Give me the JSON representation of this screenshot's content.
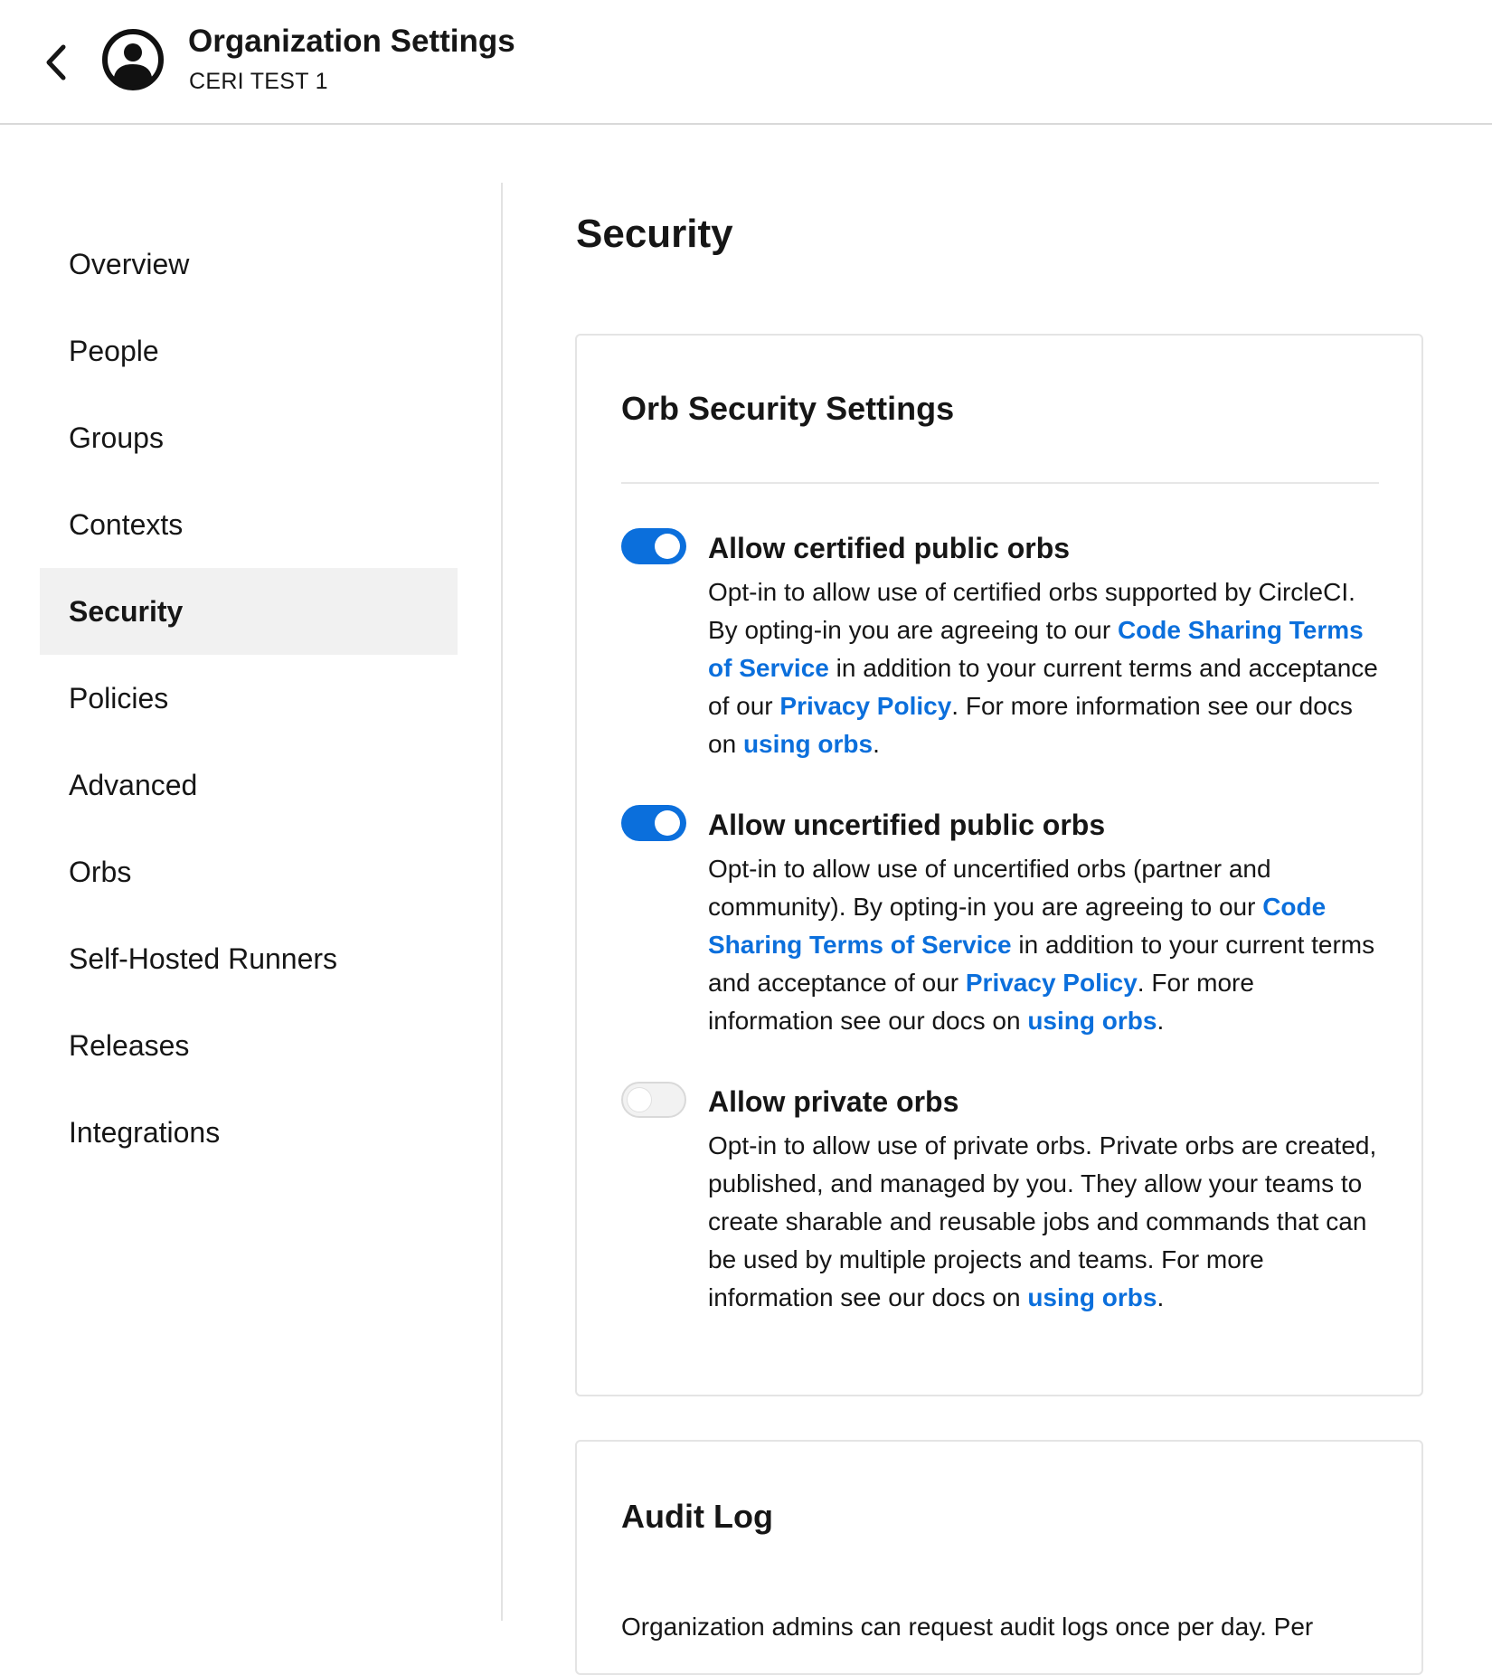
{
  "header": {
    "title": "Organization Settings",
    "org_name": "CERI TEST 1"
  },
  "sidebar": {
    "items": [
      {
        "label": "Overview"
      },
      {
        "label": "People"
      },
      {
        "label": "Groups"
      },
      {
        "label": "Contexts"
      },
      {
        "label": "Security",
        "active": true
      },
      {
        "label": "Policies"
      },
      {
        "label": "Advanced"
      },
      {
        "label": "Orbs"
      },
      {
        "label": "Self-Hosted Runners"
      },
      {
        "label": "Releases"
      },
      {
        "label": "Integrations"
      }
    ]
  },
  "main": {
    "title": "Security",
    "orb_settings": {
      "title": "Orb Security Settings",
      "settings": [
        {
          "title": "Allow certified public orbs",
          "enabled": true,
          "desc_1": "Opt-in to allow use of certified orbs supported by CircleCI. By opting-in you are agreeing to our ",
          "link_terms": "Code Sharing Terms of Service",
          "desc_2": " in addition to your current terms and acceptance of our ",
          "link_privacy": "Privacy Policy",
          "desc_3": ". For more information see our docs on ",
          "link_docs": "using orbs",
          "desc_4": "."
        },
        {
          "title": "Allow uncertified public orbs",
          "enabled": true,
          "desc_1": "Opt-in to allow use of uncertified orbs (partner and community). By opting-in you are agreeing to our ",
          "link_terms": "Code Sharing Terms of Service",
          "desc_2": " in addition to your current terms and acceptance of our ",
          "link_privacy": "Privacy Policy",
          "desc_3": ". For more information see our docs on ",
          "link_docs": "using orbs",
          "desc_4": "."
        },
        {
          "title": "Allow private orbs",
          "enabled": false,
          "desc_1": "Opt-in to allow use of private orbs. Private orbs are created, published, and managed by you. They allow your teams to create sharable and reusable jobs and commands that can be used by multiple projects and teams. For more information see our docs on ",
          "link_docs": "using orbs",
          "desc_4": "."
        }
      ]
    },
    "audit_log": {
      "title": "Audit Log",
      "text": "Organization admins can request audit logs once per day. Per"
    }
  },
  "colors": {
    "accent": "#0b6fdc",
    "active_nav_bg": "#f1f1f1",
    "text": "#161616"
  }
}
